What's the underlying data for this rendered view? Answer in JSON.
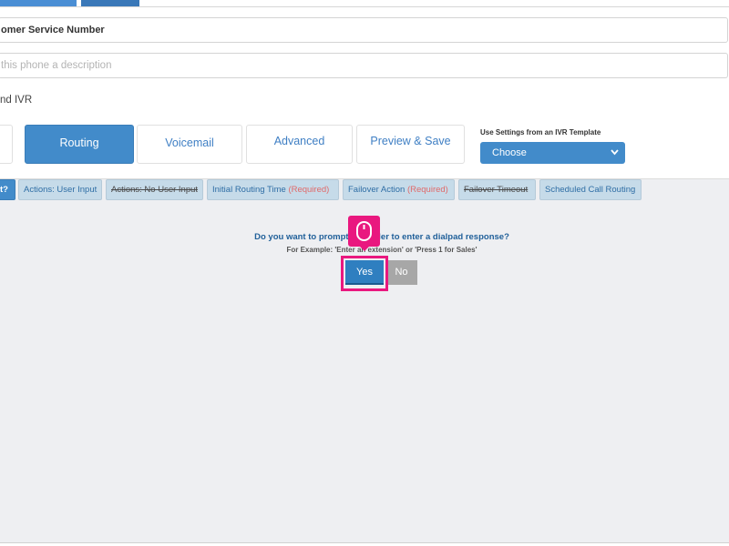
{
  "form": {
    "name_value": "omer Service Number",
    "description_placeholder": "this phone a description",
    "ivr_label": "nd IVR"
  },
  "tabs": [
    {
      "label": ""
    },
    {
      "label": "Routing"
    },
    {
      "label": "Voicemail"
    },
    {
      "label": "Advanced"
    },
    {
      "label": "Preview & Save"
    }
  ],
  "template": {
    "label": "Use Settings from an IVR Template",
    "selected": "Choose"
  },
  "steps": [
    {
      "label": "t?",
      "required": ""
    },
    {
      "label": "Actions: User Input",
      "required": ""
    },
    {
      "label": "Actions: No User Input",
      "required": ""
    },
    {
      "label": "Initial Routing Time",
      "required": "(Required)"
    },
    {
      "label": "Failover Action",
      "required": "(Required)"
    },
    {
      "label": "Failover Timeout",
      "required": ""
    },
    {
      "label": "Scheduled Call Routing",
      "required": ""
    }
  ],
  "prompt": {
    "question": "Do you want to prompt the caller to enter a dialpad response?",
    "example": "For Example: 'Enter an extension' or 'Press 1 for Sales'",
    "yes_label": "Yes",
    "no_label": "No"
  },
  "colors": {
    "accent": "#428bca",
    "highlight": "#e9187f"
  },
  "icons": {
    "cursor": "mouse-icon",
    "select_chevron": "chevron-down-icon"
  }
}
